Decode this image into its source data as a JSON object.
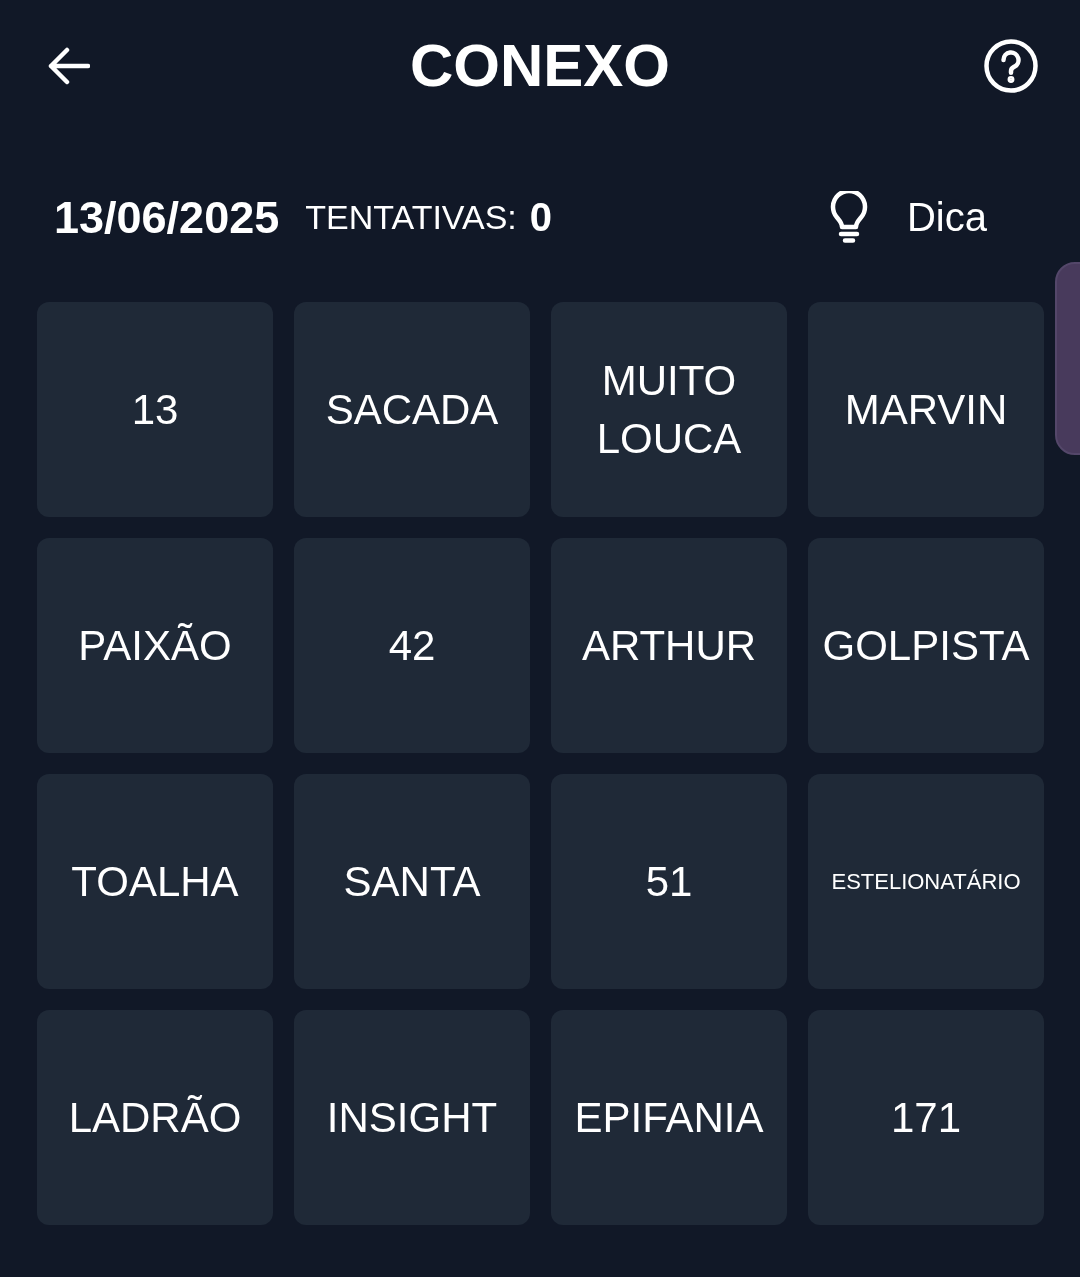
{
  "header": {
    "title": "CONEXO"
  },
  "status": {
    "date": "13/06/2025",
    "attempts_label": "TENTATIVAS:",
    "attempts": "0",
    "hint": "Dica"
  },
  "board": {
    "rows": [
      {
        "tiles": [
          {
            "label": "13",
            "selected": false
          },
          {
            "label": "SACADA",
            "selected": false
          },
          {
            "label": "MUITO LOUCA",
            "selected": false
          },
          {
            "label": "MARVIN",
            "selected": false
          }
        ]
      },
      {
        "tiles": [
          {
            "label": "PAIXÃO",
            "selected": false
          },
          {
            "label": "42",
            "selected": false
          },
          {
            "label": "ARTHUR",
            "selected": false
          },
          {
            "label": "GOLPISTA",
            "selected": false
          }
        ]
      },
      {
        "tiles": [
          {
            "label": "TOALHA",
            "selected": false
          },
          {
            "label": "SANTA",
            "selected": false
          },
          {
            "label": "51",
            "selected": false
          },
          {
            "label": "ESTELIONATÁRIO",
            "selected": false
          }
        ]
      },
      {
        "tiles": [
          {
            "label": "LADRÃO",
            "selected": false
          },
          {
            "label": "INSIGHT",
            "selected": false
          },
          {
            "label": "EPIFANIA",
            "selected": false
          },
          {
            "label": "171",
            "selected": false
          }
        ]
      }
    ]
  }
}
